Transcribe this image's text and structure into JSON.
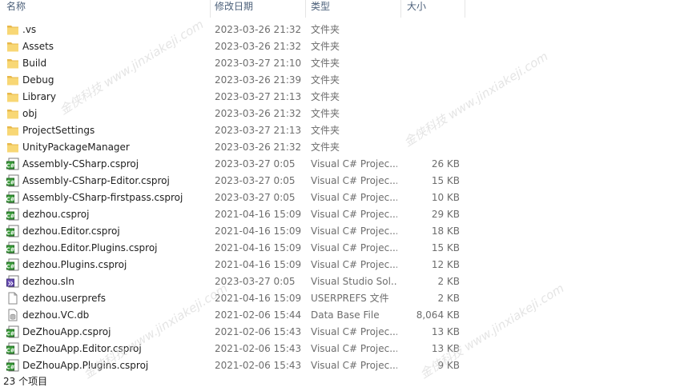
{
  "columns": {
    "name": "名称",
    "date": "修改日期",
    "type": "类型",
    "size": "大小"
  },
  "files": [
    {
      "name": ".vs",
      "date": "2023-03-26 21:32",
      "type": "文件夹",
      "size": "",
      "icon": "folder-icon"
    },
    {
      "name": "Assets",
      "date": "2023-03-26 21:32",
      "type": "文件夹",
      "size": "",
      "icon": "folder-icon"
    },
    {
      "name": "Build",
      "date": "2023-03-27 21:10",
      "type": "文件夹",
      "size": "",
      "icon": "folder-icon"
    },
    {
      "name": "Debug",
      "date": "2023-03-26 21:39",
      "type": "文件夹",
      "size": "",
      "icon": "folder-icon"
    },
    {
      "name": "Library",
      "date": "2023-03-27 21:13",
      "type": "文件夹",
      "size": "",
      "icon": "folder-icon"
    },
    {
      "name": "obj",
      "date": "2023-03-26 21:32",
      "type": "文件夹",
      "size": "",
      "icon": "folder-icon"
    },
    {
      "name": "ProjectSettings",
      "date": "2023-03-27 21:13",
      "type": "文件夹",
      "size": "",
      "icon": "folder-icon"
    },
    {
      "name": "UnityPackageManager",
      "date": "2023-03-26 21:32",
      "type": "文件夹",
      "size": "",
      "icon": "folder-icon"
    },
    {
      "name": "Assembly-CSharp.csproj",
      "date": "2023-03-27 0:05",
      "type": "Visual C# Projec...",
      "size": "26 KB",
      "icon": "csproj-icon"
    },
    {
      "name": "Assembly-CSharp-Editor.csproj",
      "date": "2023-03-27 0:05",
      "type": "Visual C# Projec...",
      "size": "15 KB",
      "icon": "csproj-icon"
    },
    {
      "name": "Assembly-CSharp-firstpass.csproj",
      "date": "2023-03-27 0:05",
      "type": "Visual C# Projec...",
      "size": "10 KB",
      "icon": "csproj-icon"
    },
    {
      "name": "dezhou.csproj",
      "date": "2021-04-16 15:09",
      "type": "Visual C# Projec...",
      "size": "29 KB",
      "icon": "csproj-icon"
    },
    {
      "name": "dezhou.Editor.csproj",
      "date": "2021-04-16 15:09",
      "type": "Visual C# Projec...",
      "size": "18 KB",
      "icon": "csproj-icon"
    },
    {
      "name": "dezhou.Editor.Plugins.csproj",
      "date": "2021-04-16 15:09",
      "type": "Visual C# Projec...",
      "size": "15 KB",
      "icon": "csproj-icon"
    },
    {
      "name": "dezhou.Plugins.csproj",
      "date": "2021-04-16 15:09",
      "type": "Visual C# Projec...",
      "size": "12 KB",
      "icon": "csproj-icon"
    },
    {
      "name": "dezhou.sln",
      "date": "2023-03-27 0:05",
      "type": "Visual Studio Sol...",
      "size": "2 KB",
      "icon": "sln-icon"
    },
    {
      "name": "dezhou.userprefs",
      "date": "2021-04-16 15:09",
      "type": "USERPREFS 文件",
      "size": "2 KB",
      "icon": "blank-file-icon"
    },
    {
      "name": "dezhou.VC.db",
      "date": "2021-02-06 15:44",
      "type": "Data Base File",
      "size": "8,064 KB",
      "icon": "db-file-icon"
    },
    {
      "name": "DeZhouApp.csproj",
      "date": "2021-02-06 15:43",
      "type": "Visual C# Projec...",
      "size": "13 KB",
      "icon": "csproj-icon"
    },
    {
      "name": "DeZhouApp.Editor.csproj",
      "date": "2021-02-06 15:43",
      "type": "Visual C# Projec...",
      "size": "13 KB",
      "icon": "csproj-icon"
    },
    {
      "name": "DeZhouApp.Plugins.csproj",
      "date": "2021-02-06 15:43",
      "type": "Visual C# Projec...",
      "size": "9 KB",
      "icon": "csproj-icon"
    }
  ],
  "status_bar": {
    "item_count": "23 个项目"
  },
  "watermark": {
    "text": "金侠科技 www.jinxiakeji.com"
  },
  "colors": {
    "folder": "#f8d775",
    "csproj": "#3a9b3a",
    "header_text": "#4c607a"
  }
}
